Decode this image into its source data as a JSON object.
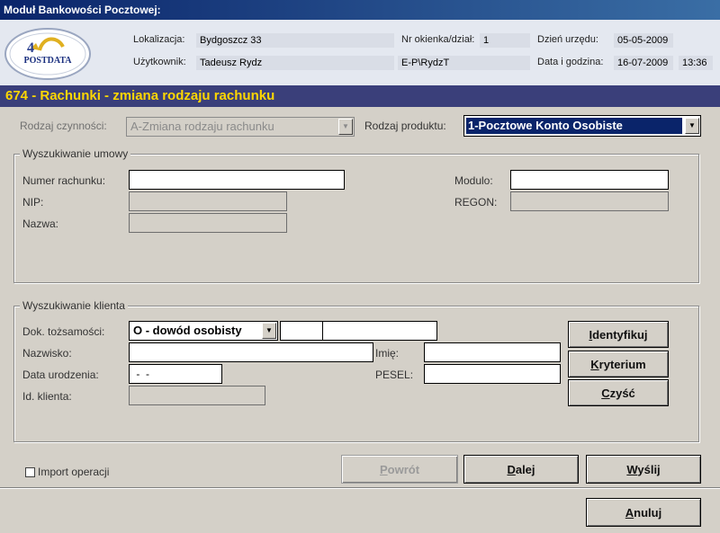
{
  "window": {
    "title": "Moduł Bankowości Pocztowej:"
  },
  "header": {
    "logo_text": "POSTDATA",
    "lokalizacja_label": "Lokalizacja:",
    "lokalizacja_value": "Bydgoszcz 33",
    "okienko_label": "Nr okienka/dział:",
    "okienko_value": "1",
    "dzien_label": "Dzień urzędu:",
    "dzien_value": "05-05-2009",
    "uzytkownik_label": "Użytkownik:",
    "uzytkownik_value": "Tadeusz Rydz",
    "login_value": "E-P\\RydzT",
    "data_label": "Data i godzina:",
    "data_value": "16-07-2009",
    "godzina_value": "13:36"
  },
  "form_title": "674 - Rachunki - zmiana rodzaju rachunku",
  "top": {
    "rodzaj_czynnosci_label": "Rodzaj czynności:",
    "rodzaj_czynnosci_value": "A-Zmiana rodzaju rachunku",
    "rodzaj_produktu_label": "Rodzaj produktu:",
    "rodzaj_produktu_value": "1-Pocztowe Konto Osobiste"
  },
  "umowa": {
    "title": "Wyszukiwanie umowy",
    "numer_label": "Numer rachunku:",
    "modulo_label": "Modulo:",
    "nip_label": "NIP:",
    "regon_label": "REGON:",
    "nazwa_label": "Nazwa:"
  },
  "klient": {
    "title": "Wyszukiwanie klienta",
    "dok_label": "Dok. tożsamości:",
    "dok_value": "O - dowód osobisty",
    "nazwisko_label": "Nazwisko:",
    "imie_label": "Imię:",
    "data_ur_label": "Data urodzenia:",
    "data_ur_value": " -  -",
    "pesel_label": "PESEL:",
    "id_label": "Id. klienta:",
    "identyfikuj_first": "I",
    "identyfikuj_rest": "dentyfikuj",
    "kryterium_first": "K",
    "kryterium_rest": "ryterium",
    "czysc_first": "C",
    "czysc_rest": "zyść"
  },
  "footer": {
    "import_label": "Import operacji",
    "powrot_first": "P",
    "powrot_rest": "owrót",
    "dalej_first": "D",
    "dalej_rest": "alej",
    "wyslij_first": "W",
    "wyslij_rest": "yślij",
    "anuluj_first": "A",
    "anuluj_rest": "nuluj"
  },
  "colors": {
    "title_bar": "#0a246a",
    "header_bg": "#e4e8f0",
    "band_bg": "#3a3f7a",
    "band_text": "#ffd700",
    "selection": "#0a246a"
  }
}
